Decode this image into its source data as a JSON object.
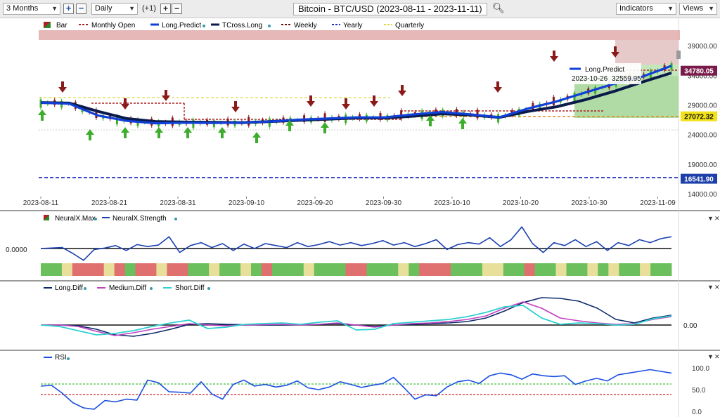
{
  "toolbar": {
    "range": "3 Months",
    "interval": "Daily",
    "offset": "(+1)",
    "title": "Bitcoin - BTC/USD (2023-08-11 - 2023-11-11)",
    "indicators": "Indicators",
    "views": "Views",
    "plus": "+",
    "minus": "−"
  },
  "legend_main": [
    "Bar",
    "Monthly Open",
    "Long.Predict",
    "TCross.Long",
    "Weekly",
    "Yearly",
    "Quarterly"
  ],
  "legend_p2": [
    "NeuralX.Max",
    "NeuralX.Strength"
  ],
  "legend_p3": [
    "Long.Diff",
    "Medium.Diff",
    "Short.Diff"
  ],
  "legend_p4": [
    "RSI"
  ],
  "tooltip": {
    "label": "Long.Predict",
    "date": "2023-10-26",
    "value": "32559.95"
  },
  "p2_axis_label": "0.0000",
  "p3_axis_label": "0.00",
  "colors": {
    "long_predict": "#1040d8",
    "tcross": "#0a1a4a",
    "up": "#3cae2c",
    "down": "#8b1a1a",
    "monthly": "#b02020",
    "yearly": "#2030c0",
    "quarterly": "#e0e060",
    "weekly": "#6a1010",
    "medium": "#c040c0",
    "short": "#30d0d0",
    "rsi": "#1a50e0"
  },
  "chart_data": [
    {
      "type": "line",
      "panel": "price",
      "x": [
        "2023-08-11",
        "2023-08-21",
        "2023-08-31",
        "2023-09-10",
        "2023-09-20",
        "2023-09-30",
        "2023-10-10",
        "2023-10-20",
        "2023-10-30",
        "2023-11-09"
      ],
      "ylim": [
        14000,
        41500
      ],
      "yticks": [
        "39000.00",
        "34000.00",
        "29000.00",
        "24000.00",
        "19000.00",
        "14000.00"
      ],
      "price_labels": [
        {
          "value": 34780.05,
          "text": "34780.05"
        },
        {
          "value": 27072.32,
          "text": "27072.32"
        },
        {
          "value": 16541.9,
          "text": "16541.90"
        }
      ],
      "series": [
        {
          "name": "Long.Predict",
          "values": [
            29400,
            29200,
            27200,
            26300,
            25900,
            26000,
            25950,
            26000,
            26200,
            26500,
            26700,
            26900,
            26900,
            27400,
            27800,
            27400,
            26900,
            28400,
            29600,
            31100,
            32560,
            33800,
            35600
          ]
        },
        {
          "name": "TCross.Long",
          "values": [
            29400,
            29300,
            27900,
            26700,
            26200,
            26100,
            26050,
            26000,
            26200,
            26400,
            26600,
            26800,
            26800,
            27100,
            27500,
            27300,
            26900,
            27900,
            28700,
            29900,
            31300,
            32900,
            34400
          ]
        }
      ]
    },
    {
      "type": "line",
      "panel": "neuralx",
      "series": [
        {
          "name": "NeuralX.Strength",
          "values": [
            0,
            0.05,
            0.1,
            -0.5,
            -1.2,
            -0.1,
            0.05,
            0.3,
            -0.2,
            0.4,
            0.2,
            0.35,
            1.2,
            -0.4,
            0.3,
            0.6,
            0.1,
            0.5,
            -0.2,
            0.45,
            0.0,
            0.5,
            0.3,
            0.1,
            0.6,
            0.2,
            0.4,
            0.7,
            0.35,
            0.6,
            0.3,
            0.5,
            0.8,
            0.35,
            0.6,
            0.2,
            0.5,
            0.9,
            -0.1,
            0.4,
            0.6,
            0.45,
            1.1,
            0.2,
            0.9,
            2.2,
            0.5,
            -0.4,
            0.6,
            0.3,
            0.9,
            0.2,
            0.7,
            -0.2,
            0.6,
            0.3,
            0.9,
            0.6,
            1.0,
            1.2
          ]
        }
      ]
    },
    {
      "type": "line",
      "panel": "diff",
      "series": [
        {
          "name": "Long.Diff",
          "values": [
            0.0,
            0.0,
            -0.1,
            -0.6,
            -1.4,
            -1.6,
            -1.2,
            -0.6,
            0.1,
            0.2,
            0.1,
            0.05,
            0.0,
            0.0,
            0.05,
            0.1,
            0.2,
            0.0,
            -0.2,
            0.0,
            0.1,
            0.2,
            0.3,
            0.5,
            1.0,
            2.0,
            3.2,
            3.9,
            3.8,
            3.4,
            2.4,
            0.8,
            0.3,
            1.0,
            1.4
          ]
        },
        {
          "name": "Medium.Diff",
          "values": [
            0.0,
            0.0,
            -0.2,
            -0.9,
            -1.5,
            -1.1,
            -0.6,
            -0.2,
            0.2,
            0.0,
            -0.1,
            0.0,
            0.05,
            0.1,
            0.0,
            0.1,
            0.3,
            0.0,
            -0.3,
            0.0,
            0.2,
            0.3,
            0.5,
            0.8,
            1.3,
            2.4,
            3.3,
            2.4,
            1.0,
            0.6,
            0.3,
            0.1,
            0.2,
            0.8,
            1.2
          ]
        },
        {
          "name": "Short.Diff",
          "values": [
            0.0,
            -0.2,
            -0.8,
            -1.4,
            -1.2,
            -0.8,
            -0.2,
            0.3,
            0.7,
            -0.5,
            -0.3,
            0.1,
            0.2,
            0.3,
            0.1,
            0.4,
            0.6,
            -0.7,
            -0.6,
            0.2,
            0.4,
            0.6,
            0.8,
            1.2,
            1.8,
            2.6,
            2.8,
            1.0,
            0.1,
            0.3,
            0.2,
            0.0,
            0.1,
            0.9,
            1.3
          ]
        }
      ]
    },
    {
      "type": "line",
      "panel": "rsi",
      "ylim": [
        0,
        100
      ],
      "yticks": [
        "100.0",
        "50.0",
        "0.0"
      ],
      "series": [
        {
          "name": "RSI",
          "values": [
            58,
            60,
            42,
            20,
            8,
            5,
            25,
            22,
            28,
            26,
            72,
            66,
            45,
            44,
            42,
            68,
            40,
            28,
            62,
            72,
            58,
            62,
            56,
            60,
            70,
            54,
            50,
            56,
            68,
            62,
            55,
            60,
            64,
            78,
            54,
            28,
            38,
            36,
            56,
            68,
            72,
            64,
            82,
            88,
            84,
            74,
            86,
            82,
            80,
            82,
            62,
            70,
            76,
            70,
            84,
            88,
            92,
            96,
            92,
            88
          ]
        }
      ]
    }
  ]
}
